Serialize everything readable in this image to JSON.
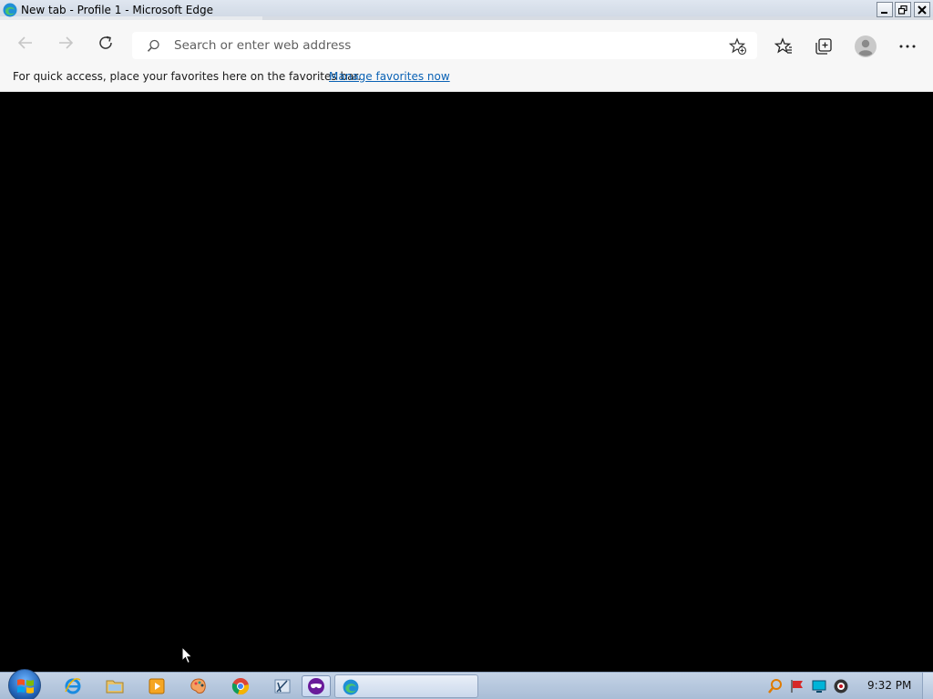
{
  "window": {
    "title": "New tab - Profile 1 - Microsoft Edge"
  },
  "toolbar": {
    "address_placeholder": "Search or enter web address"
  },
  "favorites_bar": {
    "message": "For quick access, place your favorites here on the favorites bar.",
    "link_label": "Manage favorites now"
  },
  "taskbar": {
    "pinned_apps": [
      "internet-explorer",
      "file-explorer",
      "media-player",
      "paint-app",
      "chrome",
      "snipping-tool",
      "vpn-mask-app"
    ],
    "open_window": "microsoft-edge",
    "tray_icons": [
      "search-tool",
      "flag",
      "network",
      "volume"
    ],
    "clock": "9:32 PM"
  },
  "colors": {
    "content_background": "#000000",
    "link": "#0a62b5",
    "taskbar": "#b4c6dd"
  }
}
